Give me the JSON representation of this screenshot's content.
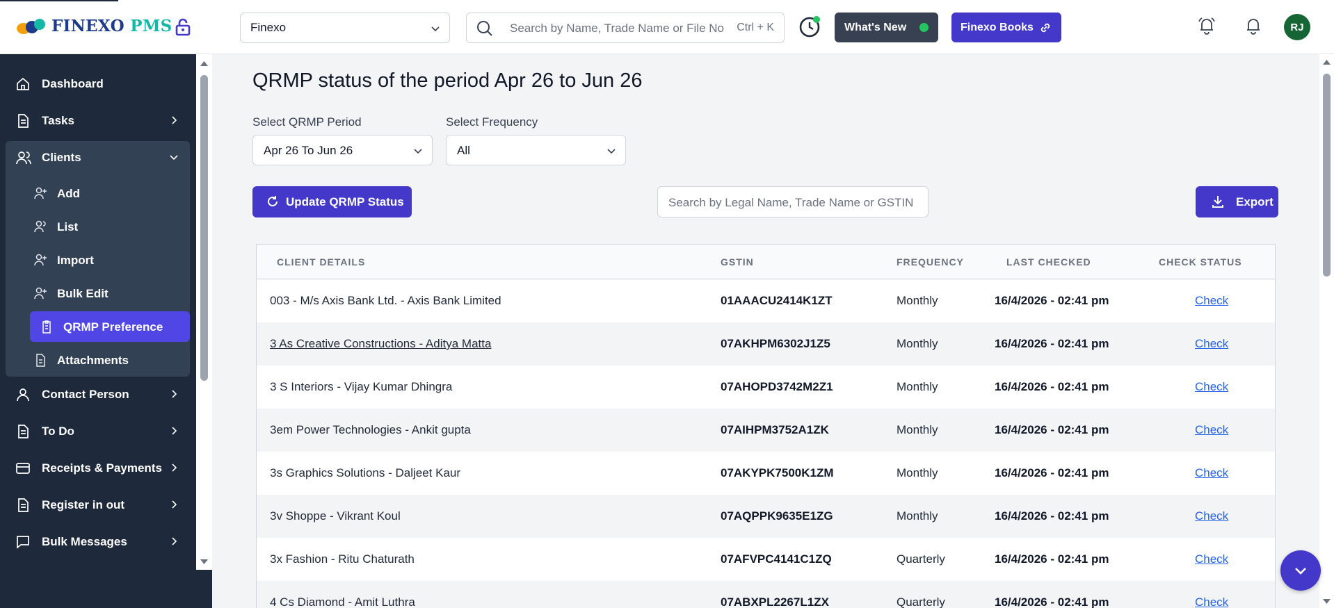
{
  "header": {
    "brand_name": "FINEXO",
    "brand_suffix": "PMS",
    "org_select_value": "Finexo",
    "search_placeholder": "Search by Name, Trade Name or File No",
    "search_shortcut": "Ctrl + K",
    "whats_new_label": "What's New",
    "books_label": "Finexo Books",
    "avatar_initials": "RJ"
  },
  "sidebar": {
    "items": [
      {
        "label": "Dashboard",
        "icon": "home-icon"
      },
      {
        "label": "Tasks",
        "icon": "document-icon"
      },
      {
        "label": "Clients",
        "icon": "users-icon",
        "expanded": true
      },
      {
        "label": "Contact Person",
        "icon": "user-icon"
      },
      {
        "label": "To Do",
        "icon": "document-icon"
      },
      {
        "label": "Receipts & Payments",
        "icon": "card-icon"
      },
      {
        "label": "Register in out",
        "icon": "document-icon"
      },
      {
        "label": "Bulk Messages",
        "icon": "chat-icon"
      }
    ],
    "client_sub_items": [
      {
        "label": "Add"
      },
      {
        "label": "List"
      },
      {
        "label": "Import"
      },
      {
        "label": "Bulk Edit"
      },
      {
        "label": "QRMP Preference",
        "active": true
      },
      {
        "label": "Attachments"
      }
    ]
  },
  "page": {
    "title": "QRMP status of the period Apr 26 to Jun 26",
    "period_label": "Select QRMP Period",
    "period_value": "Apr 26 To Jun 26",
    "frequency_label": "Select Frequency",
    "frequency_value": "All",
    "update_button": "Update QRMP Status",
    "table_search_placeholder": "Search by Legal Name, Trade Name or GSTIN",
    "export_button": "Export"
  },
  "table": {
    "columns": [
      "CLIENT DETAILS",
      "GSTIN",
      "FREQUENCY",
      "LAST CHECKED",
      "CHECK STATUS"
    ],
    "rows": [
      {
        "client": "003 - M/s Axis Bank Ltd. - Axis Bank Limited",
        "gstin": "01AAACU2414K1ZT",
        "frequency": "Monthly",
        "last_checked": "16/4/2026 - 02:41 pm",
        "action": "Check"
      },
      {
        "client": "3 As Creative Constructions - Aditya Matta",
        "gstin": "07AKHPM6302J1Z5",
        "frequency": "Monthly",
        "last_checked": "16/4/2026 - 02:41 pm",
        "action": "Check"
      },
      {
        "client": "3 S Interiors - Vijay Kumar Dhingra",
        "gstin": "07AHOPD3742M2Z1",
        "frequency": "Monthly",
        "last_checked": "16/4/2026 - 02:41 pm",
        "action": "Check"
      },
      {
        "client": "3em Power Technologies - Ankit gupta",
        "gstin": "07AIHPM3752A1ZK",
        "frequency": "Monthly",
        "last_checked": "16/4/2026 - 02:41 pm",
        "action": "Check"
      },
      {
        "client": "3s Graphics Solutions - Daljeet Kaur",
        "gstin": "07AKYPK7500K1ZM",
        "frequency": "Monthly",
        "last_checked": "16/4/2026 - 02:41 pm",
        "action": "Check"
      },
      {
        "client": "3v Shoppe - Vikrant Koul",
        "gstin": "07AQPPK9635E1ZG",
        "frequency": "Monthly",
        "last_checked": "16/4/2026 - 02:41 pm",
        "action": "Check"
      },
      {
        "client": "3x Fashion - Ritu Chaturath",
        "gstin": "07AFVPC4141C1ZQ",
        "frequency": "Quarterly",
        "last_checked": "16/4/2026 - 02:41 pm",
        "action": "Check"
      },
      {
        "client": "4 Cs Diamond - Amit Luthra",
        "gstin": "07ABXPL2267L1ZX",
        "frequency": "Quarterly",
        "last_checked": "16/4/2026 - 02:41 pm",
        "action": "Check"
      }
    ]
  },
  "colors": {
    "primary": "#4338ca",
    "sidebar_bg": "#1e293b",
    "active_item": "#4f46e5",
    "link": "#2563eb",
    "status_green": "#22c55e"
  }
}
